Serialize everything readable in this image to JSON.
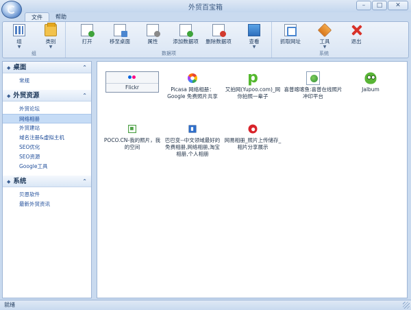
{
  "window": {
    "title": "外贸百宝箱",
    "min_glyph": "–",
    "max_glyph": "□",
    "close_glyph": "✕"
  },
  "ribbon": {
    "tabs": [
      {
        "label": "文件"
      },
      {
        "label": "帮助"
      }
    ],
    "groups": [
      {
        "label": "组",
        "buttons": [
          {
            "label": "组",
            "icon": "group-icon"
          },
          {
            "label": "类别",
            "icon": "category-icon"
          }
        ]
      },
      {
        "label": "数据项",
        "buttons": [
          {
            "label": "打开",
            "icon": "open-icon"
          },
          {
            "label": "移至桌面",
            "icon": "move-to-desktop-icon"
          },
          {
            "label": "属性",
            "icon": "properties-icon"
          },
          {
            "label": "添加数据项",
            "icon": "add-item-icon"
          },
          {
            "label": "删除数据项",
            "icon": "delete-item-icon"
          },
          {
            "label": "查看",
            "icon": "view-icon"
          }
        ]
      },
      {
        "label": "系统",
        "buttons": [
          {
            "label": "抓取网址",
            "icon": "fetch-url-icon"
          },
          {
            "label": "工具",
            "icon": "tools-icon"
          },
          {
            "label": "退出",
            "icon": "exit-icon"
          }
        ]
      }
    ],
    "caret": "▼"
  },
  "sidebar": {
    "bullet": "◆",
    "chevron": "⌃",
    "sections": [
      {
        "title": "桌面",
        "items": [
          "常规"
        ]
      },
      {
        "title": "外贸资源",
        "items": [
          "外贸论坛",
          "网络相册",
          "外贸建站",
          "域名注册&虚拟主机",
          "SEO优化",
          "SEO资源",
          "Google工具"
        ],
        "selected": "网络相册"
      },
      {
        "title": "系统",
        "items": [
          "贝恩软件",
          "最新外贸资讯"
        ]
      }
    ]
  },
  "main": {
    "items": [
      {
        "label": "Flickr",
        "icon": "flickr-icon"
      },
      {
        "label": "Picasa 网络相册：Google 免费照片共享",
        "icon": "picasa-icon"
      },
      {
        "label": "又拍网(Yupoo.com)_网你拍照一辈子",
        "icon": "yupoo-icon"
      },
      {
        "label": "喜普喀喀鱼:喜普在线照片冲印平台",
        "icon": "photo-print-icon"
      },
      {
        "label": "Jalbum",
        "icon": "jalbum-icon"
      },
      {
        "label": "POCO.CN-我的照片，我的空间",
        "icon": "poco-icon"
      },
      {
        "label": "巴巴变--中文领域最好的免费相册,网络相册,淘宝相册,个人相册",
        "icon": "bababian-icon"
      },
      {
        "label": "网易相册_照片上传储存_相片分享展示",
        "icon": "netease-icon"
      }
    ]
  },
  "statusbar": {
    "text": "就绪"
  },
  "colors": {
    "frame": "#c9daef",
    "accent": "#1f4d9a",
    "selection": "#c6dcf6"
  }
}
